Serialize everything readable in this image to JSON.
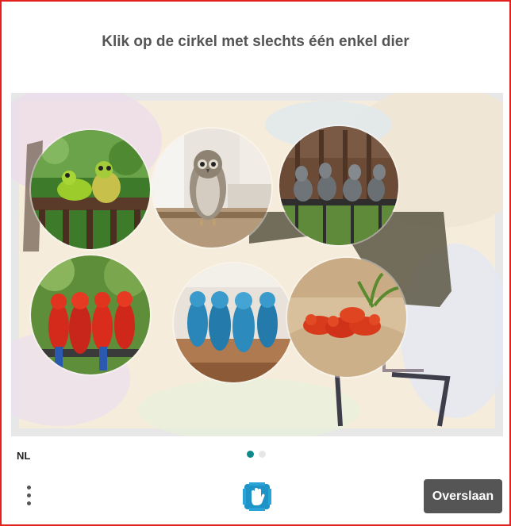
{
  "captcha": {
    "prompt": "Klik op de cirkel met slechts één enkel dier",
    "tiles": [
      {
        "name": "frogs-two"
      },
      {
        "name": "owl-single"
      },
      {
        "name": "lizards-group"
      },
      {
        "name": "parrots-red-group"
      },
      {
        "name": "parrots-blue-group"
      },
      {
        "name": "frogs-red-group"
      }
    ]
  },
  "footer": {
    "language": "NL",
    "page_dots": {
      "count": 2,
      "active": 0
    },
    "skip_label": "Overslaan",
    "menu_icon": "more-vertical-icon",
    "logo_icon": "hand-logo-icon"
  },
  "colors": {
    "border": "#e2221f",
    "prompt_text": "#555555",
    "skip_button": "#555555",
    "active_dot": "#0f8a8a"
  }
}
